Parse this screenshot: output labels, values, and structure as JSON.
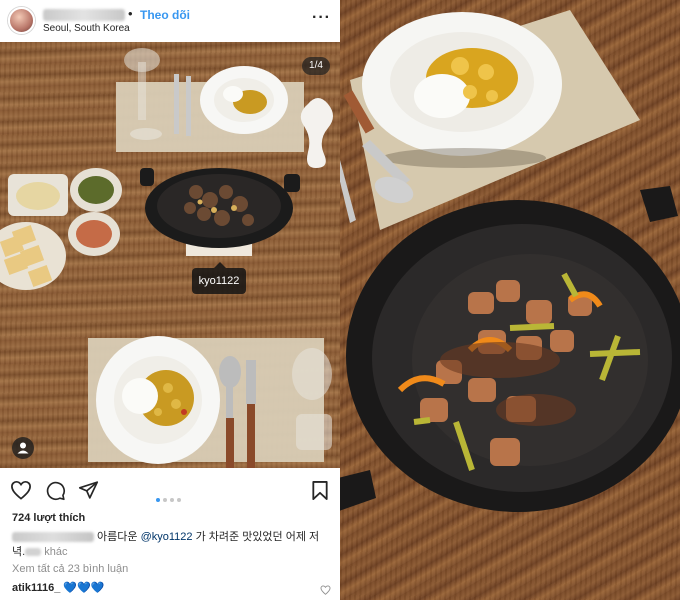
{
  "post": {
    "follow_label": "Theo dõi",
    "location": "Seoul, South Korea",
    "more_icon": "more-horizontal-icon",
    "image_counter": "1/4",
    "tag_username": "kyo1122",
    "carousel": {
      "total": 4,
      "active": 1
    },
    "likes": "724 lượt thích",
    "caption": {
      "text_before": " 아름다운 ",
      "mention": "@kyo1122",
      "text_after": " 가 차려준 맛있었던 어제 저",
      "line2": "녁.",
      "more": " khác"
    },
    "view_comments": "Xem tất cả 23 bình luận",
    "comment": {
      "user": "atik1116_",
      "text": " 💙💙💙"
    }
  },
  "colors": {
    "accent": "#3897f0",
    "mention": "#003569",
    "muted": "#8e8e8e"
  },
  "icons": [
    "heart-icon",
    "comment-icon",
    "share-icon",
    "bookmark-icon",
    "user-tag-icon"
  ]
}
